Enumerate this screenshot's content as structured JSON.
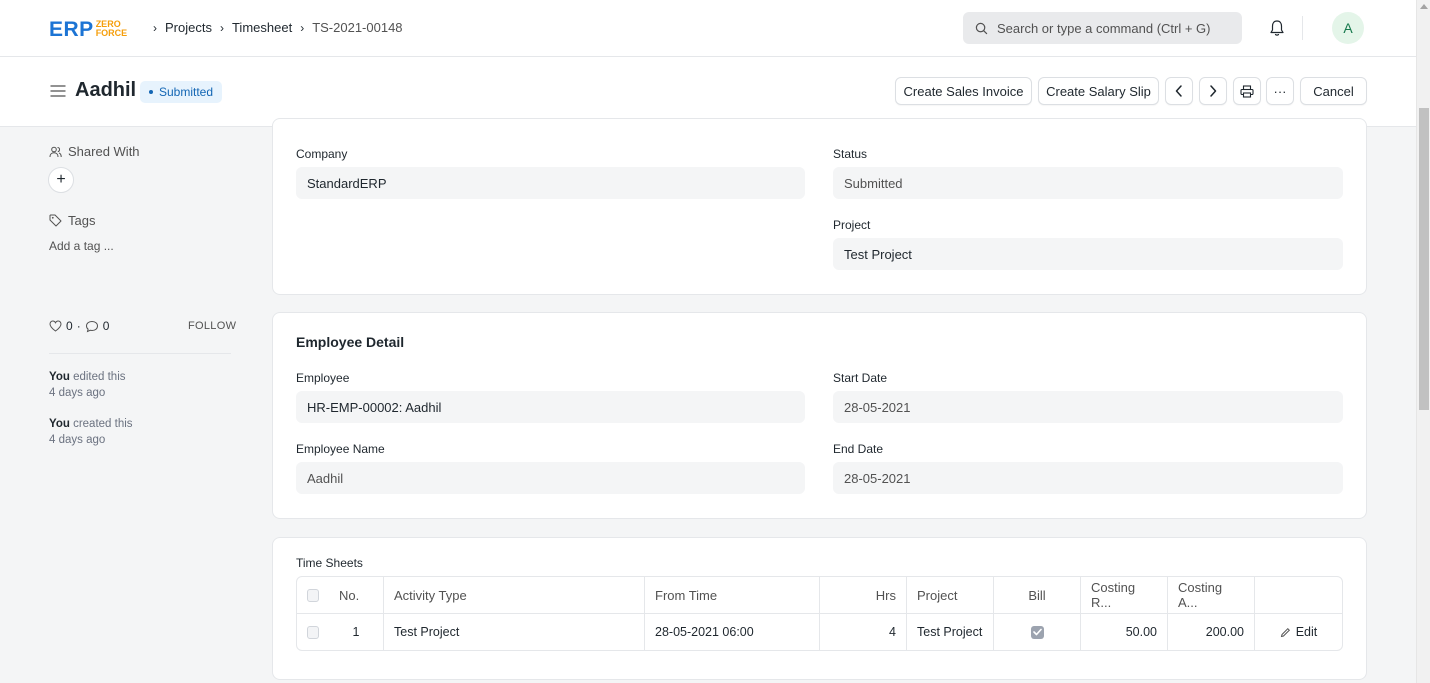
{
  "navbar": {
    "logo_main": "ERP",
    "logo_sub_top": "ZERO",
    "logo_sub_bottom": "FORCE",
    "breadcrumbs": [
      "Projects",
      "Timesheet",
      "TS-2021-00148"
    ],
    "search_placeholder": "Search or type a command (Ctrl + G)",
    "avatar_initial": "A"
  },
  "page_head": {
    "title": "Aadhil",
    "status": "Submitted",
    "buttons": {
      "create_sales_invoice": "Create Sales Invoice",
      "create_salary_slip": "Create Salary Slip",
      "more": "···",
      "cancel": "Cancel"
    }
  },
  "sidebar": {
    "shared_with": "Shared With",
    "tags": "Tags",
    "add_tag": "Add a tag ...",
    "likes_count": "0",
    "comments_count": "0",
    "follow": "FOLLOW",
    "activity": [
      {
        "user": "You",
        "action": " edited this",
        "time": "4 days ago"
      },
      {
        "user": "You",
        "action": " created this",
        "time": "4 days ago"
      }
    ]
  },
  "form": {
    "company_label": "Company",
    "company_value": "StandardERP",
    "status_label": "Status",
    "status_value": "Submitted",
    "project_label": "Project",
    "project_value": "Test Project",
    "employee_detail_title": "Employee Detail",
    "employee_label": "Employee",
    "employee_value": "HR-EMP-00002: Aadhil",
    "start_date_label": "Start Date",
    "start_date_value": "28-05-2021",
    "employee_name_label": "Employee Name",
    "employee_name_value": "Aadhil",
    "end_date_label": "End Date",
    "end_date_value": "28-05-2021"
  },
  "time_sheets": {
    "title": "Time Sheets",
    "columns": [
      "No.",
      "Activity Type",
      "From Time",
      "Hrs",
      "Project",
      "Bill",
      "Costing R...",
      "Costing A..."
    ],
    "rows": [
      {
        "no": "1",
        "activity_type": "Test Project",
        "from_time": "28-05-2021 06:00",
        "hrs": "4",
        "project": "Test Project",
        "bill": true,
        "costing_rate": "50.00",
        "costing_amount": "200.00",
        "edit": "Edit"
      }
    ]
  },
  "colors": {
    "brand": "#1c74d4",
    "accent_orange": "#f59e0b",
    "status_blue": "#1366b4"
  }
}
